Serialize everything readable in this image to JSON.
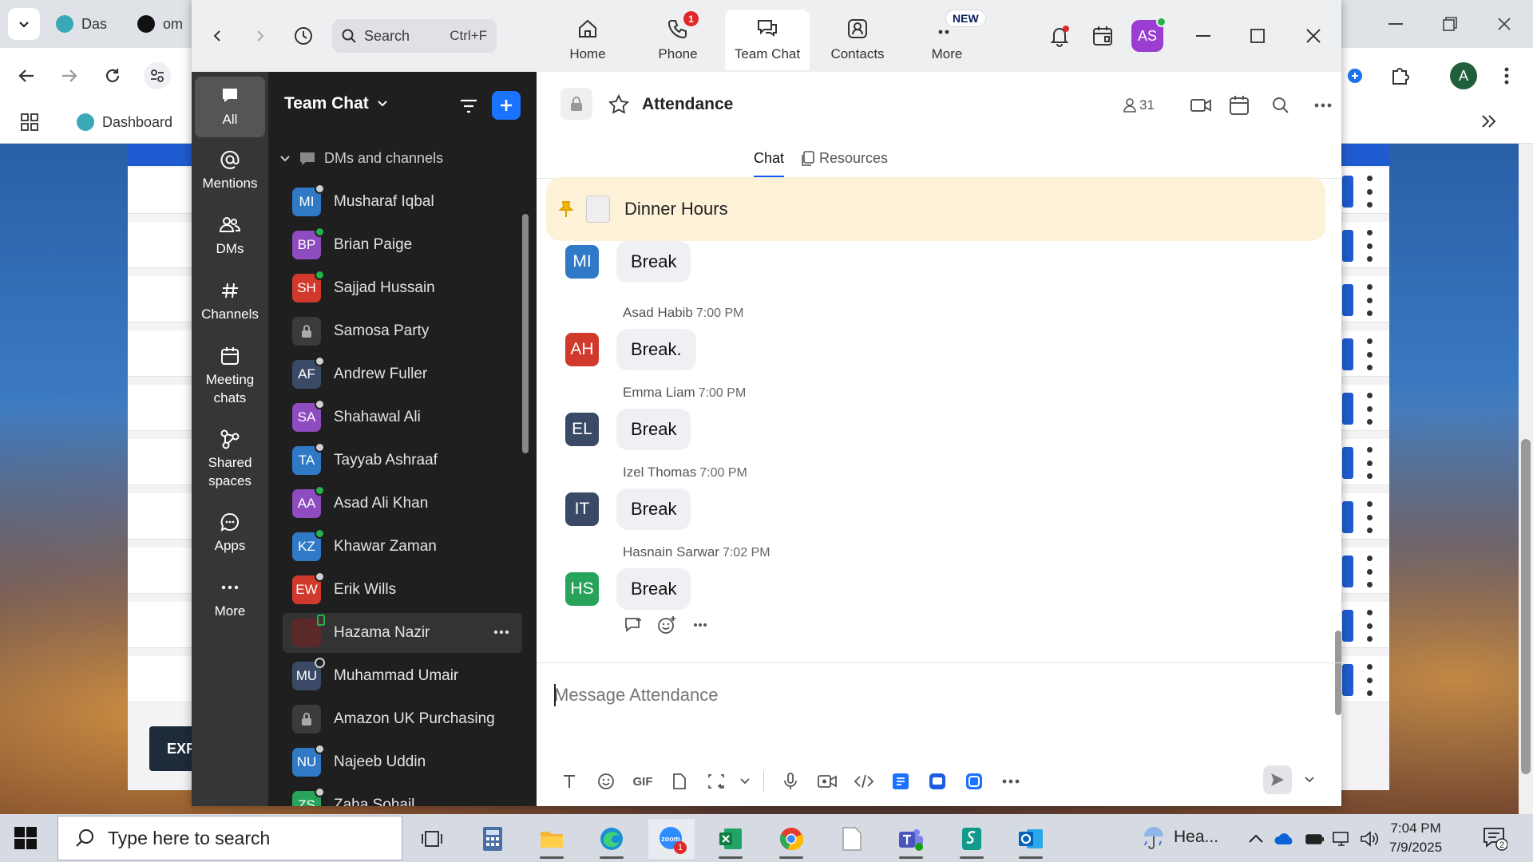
{
  "browser": {
    "tabs": [
      "Das",
      "om"
    ],
    "bookmark": "Dashboard",
    "profile_initial": "A",
    "export_button": "EXP"
  },
  "zoom": {
    "search": {
      "placeholder": "Search",
      "shortcut": "Ctrl+F"
    },
    "tabs": [
      {
        "label": "Home",
        "icon": "home-icon"
      },
      {
        "label": "Phone",
        "icon": "phone-icon",
        "badge": "1"
      },
      {
        "label": "Team Chat",
        "icon": "team-chat-icon",
        "active": true
      },
      {
        "label": "Contacts",
        "icon": "contacts-icon"
      },
      {
        "label": "More",
        "icon": "more-icon",
        "badge": "NEW"
      }
    ],
    "user_initials": "AS",
    "accent_color": "#0b5cff"
  },
  "rail": {
    "items": [
      {
        "label": "All",
        "icon": "chat-bubble-icon",
        "active": true
      },
      {
        "label": "Mentions",
        "icon": "at-icon"
      },
      {
        "label": "DMs",
        "icon": "people-icon"
      },
      {
        "label": "Channels",
        "icon": "hash-icon"
      },
      {
        "label": "Meeting chats",
        "icon": "calendar-icon"
      },
      {
        "label": "Shared spaces",
        "icon": "shared-spaces-icon"
      },
      {
        "label": "Apps",
        "icon": "apps-icon"
      },
      {
        "label": "More",
        "icon": "more-dots-icon"
      }
    ]
  },
  "list": {
    "title": "Team Chat",
    "section": "DMs and channels",
    "contacts": [
      {
        "initials": "MI",
        "name": "Musharaf Iqbal",
        "color": "#2f79c7",
        "status": "away"
      },
      {
        "initials": "BP",
        "name": "Brian Paige",
        "color": "#8f4bc0",
        "status": "online"
      },
      {
        "initials": "SH",
        "name": "Sajjad Hussain",
        "color": "#d0392b",
        "status": "online"
      },
      {
        "initials": "",
        "name": "Samosa Party",
        "color": "#3b3b3b",
        "status": "locked"
      },
      {
        "initials": "AF",
        "name": "Andrew Fuller",
        "color": "#3a4a66",
        "status": "away"
      },
      {
        "initials": "SA",
        "name": "Shahawal Ali",
        "color": "#8f4bc0",
        "status": "away"
      },
      {
        "initials": "TA",
        "name": "Tayyab Ashraaf",
        "color": "#2f79c7",
        "status": "away"
      },
      {
        "initials": "AA",
        "name": "Asad Ali Khan",
        "color": "#8f4bc0",
        "status": "online"
      },
      {
        "initials": "KZ",
        "name": "Khawar Zaman",
        "color": "#2f79c7",
        "status": "online"
      },
      {
        "initials": "EW",
        "name": "Erik Wills",
        "color": "#d0392b",
        "status": "away"
      },
      {
        "initials": "",
        "name": "Hazama Nazir",
        "color": "#5a2a2a",
        "status": "mobile",
        "highlight": true
      },
      {
        "initials": "MU",
        "name": "Muhammad Umair",
        "color": "#3a4a66",
        "status": "offline"
      },
      {
        "initials": "",
        "name": "Amazon UK Purchasing",
        "color": "#3b3b3b",
        "status": "locked"
      },
      {
        "initials": "NU",
        "name": "Najeeb Uddin",
        "color": "#2f79c7",
        "status": "away"
      },
      {
        "initials": "ZS",
        "name": "Zaha Sohail",
        "color": "#27a35a",
        "status": "away"
      }
    ]
  },
  "chat": {
    "channel": "Attendance",
    "member_count": "31",
    "tabs": [
      "Chat",
      "Resources"
    ],
    "pinned": "Dinner Hours",
    "messages": [
      {
        "initials": "MI",
        "color": "#2f79c7",
        "sender": "",
        "time": "",
        "text": "Break"
      },
      {
        "initials": "AH",
        "color": "#d0392b",
        "sender": "Asad Habib",
        "time": "7:00 PM",
        "text": "Break."
      },
      {
        "initials": "EL",
        "color": "#3a4a66",
        "sender": "Emma Liam",
        "time": "7:00 PM",
        "text": "Break"
      },
      {
        "initials": "IT",
        "color": "#3a4a66",
        "sender": "Izel Thomas",
        "time": "7:00 PM",
        "text": "Break"
      },
      {
        "initials": "HS",
        "color": "#27a35a",
        "sender": "Hasnain Sarwar",
        "time": "7:02 PM",
        "text": "Break"
      }
    ],
    "composer_placeholder": "Message Attendance",
    "toolbar_gif": "GIF"
  },
  "taskbar": {
    "search_placeholder": "Type here to search",
    "weather": "Hea...",
    "time": "7:04 PM",
    "date": "7/9/2025",
    "notification_count": "2",
    "zoom_badge": "1"
  }
}
